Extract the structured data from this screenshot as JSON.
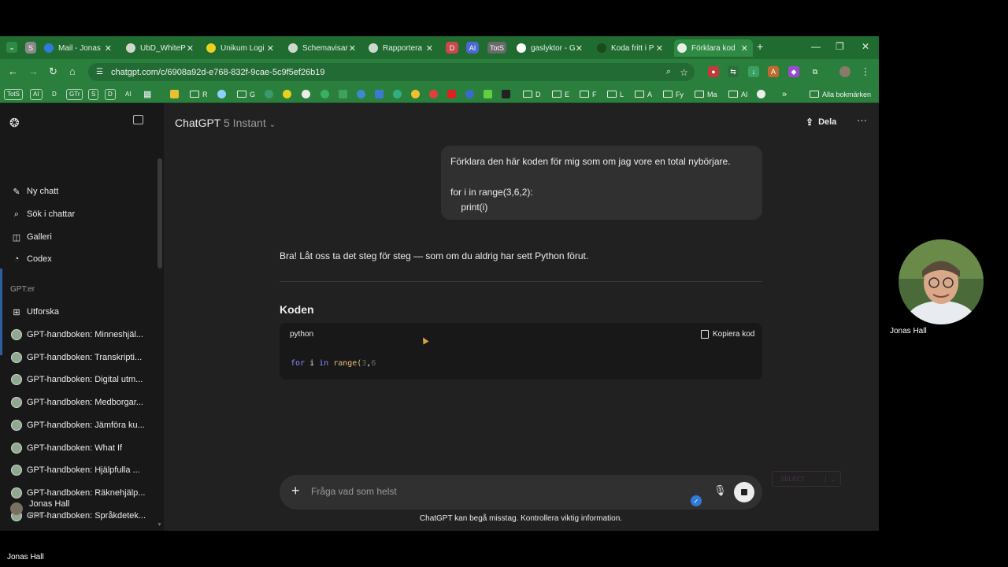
{
  "browser": {
    "tabs": [
      {
        "label": "Mail - Jonas",
        "icon": "outlook-icon"
      },
      {
        "label": "UbD_WhiteP",
        "icon": "globe-icon"
      },
      {
        "label": "Unikum Logi",
        "icon": "unikum-icon"
      },
      {
        "label": "Schemavisar",
        "icon": "globe-icon"
      },
      {
        "label": "Rapportera",
        "icon": "globe-icon"
      },
      {
        "label": "gaslyktor - G",
        "icon": "google-icon"
      },
      {
        "label": "Koda fritt i P",
        "icon": "globe-icon"
      },
      {
        "label": "Förklara kod",
        "icon": "chatgpt-icon",
        "active": true
      }
    ],
    "pinned_tabs": [
      "S",
      "D",
      "AI",
      "TotS"
    ],
    "url": "chatgpt.com/c/6908a92d-e768-832f-9cae-5c9f5ef26b19",
    "bookmarks": {
      "chips": [
        "TotS",
        "AI",
        "D",
        "GTr",
        "S",
        "D",
        "AI"
      ],
      "folders": [
        "R",
        "G",
        "D",
        "E",
        "F",
        "L",
        "A",
        "Fy",
        "Ma",
        "AI"
      ],
      "all_label": "Alla bokmärken"
    }
  },
  "sidebar": {
    "items": [
      {
        "label": "Ny chatt",
        "icon": "edit-icon"
      },
      {
        "label": "Sök i chattar",
        "icon": "search-icon"
      },
      {
        "label": "Galleri",
        "icon": "gallery-icon"
      },
      {
        "label": "Codex",
        "icon": "codex-icon"
      }
    ],
    "gpts_heading": "GPT:er",
    "explore": "Utforska",
    "gpts": [
      "GPT-handboken: Minneshjäl...",
      "GPT-handboken: Transkripti...",
      "GPT-handboken: Digital utm...",
      "GPT-handboken: Medborgar...",
      "GPT-handboken: Jämföra ku...",
      "GPT-handboken: What If",
      "GPT-handboken: Hjälpfulla ...",
      "GPT-handboken: Räknehjälp...",
      "GPT-handboken: Språkdetek..."
    ],
    "account": {
      "name": "Jonas Hall",
      "plan": "Plus"
    }
  },
  "main": {
    "model_name": "ChatGPT",
    "model_variant": "5 Instant",
    "share_label": "Dela",
    "user_message_line1": "Förklara den här koden för mig som om jag vore en total nybörjare.",
    "user_message_line2": "for i in range(3,6,2):",
    "user_message_line3": "    print(i)",
    "assistant_intro": "Bra! Låt oss ta det steg för steg — som om du aldrig har sett Python förut.",
    "section_heading": "Koden",
    "code": {
      "language": "python",
      "copy_label": "Kopiera kod",
      "tok_for": "for",
      "tok_i": " i ",
      "tok_in": "in",
      "tok_range": " range(",
      "tok_3": "3",
      "tok_comma": ",",
      "tok_6": "6"
    },
    "composer": {
      "placeholder": "Fråga vad som helst"
    },
    "disclaimer": "ChatGPT kan begå misstag. Kontrollera viktig information.",
    "select_label": "SELECT"
  },
  "webcam": {
    "name": "Jonas Hall"
  },
  "footer_name": "Jonas Hall"
}
